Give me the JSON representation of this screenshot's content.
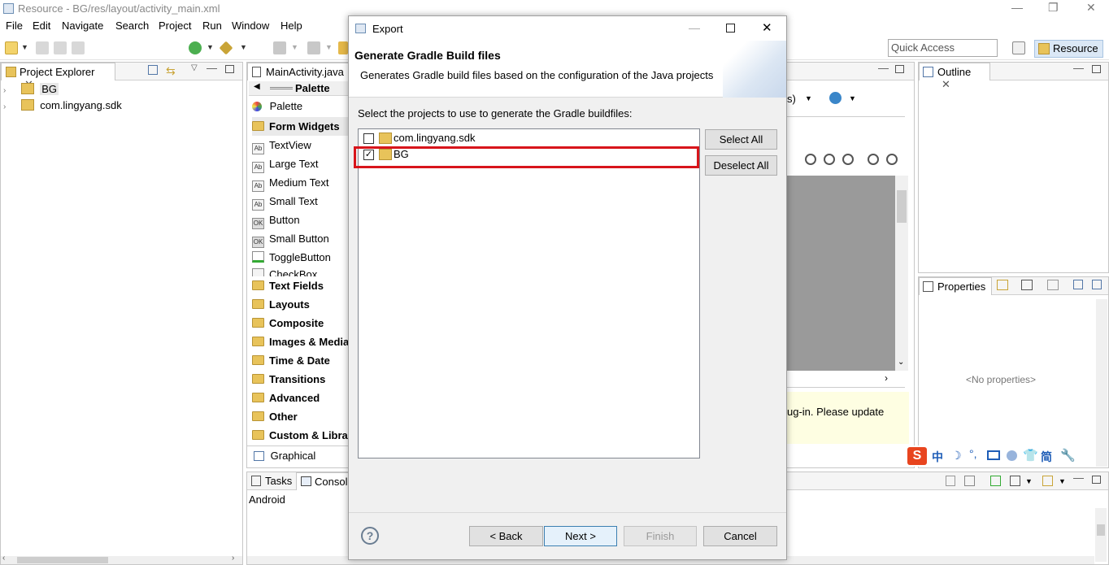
{
  "window": {
    "title": "Resource - BG/res/layout/activity_main.xml",
    "controls": [
      "—",
      "❐",
      "✕"
    ]
  },
  "menu": [
    "File",
    "Edit",
    "Navigate",
    "Search",
    "Project",
    "Run",
    "Window",
    "Help"
  ],
  "toolbar": {
    "quick_access": "Quick Access",
    "perspective": "Resource"
  },
  "project_explorer": {
    "tab": "Project Explorer",
    "items": [
      {
        "label": "BG",
        "selected": true
      },
      {
        "label": "com.lingyang.sdk",
        "selected": false
      }
    ]
  },
  "editor": {
    "tab": "MainActivity.java",
    "palette_header": "Palette",
    "palette_title": "Palette",
    "widgets": [
      {
        "icon": "Ab",
        "label": "TextView"
      },
      {
        "icon": "Ab",
        "label": "Large Text"
      },
      {
        "icon": "Ab",
        "label": "Medium Text"
      },
      {
        "icon": "Ab",
        "label": "Small Text"
      },
      {
        "icon": "OK",
        "label": "Button"
      },
      {
        "icon": "OK",
        "label": "Small Button"
      },
      {
        "icon": "toggle",
        "label": "ToggleButton"
      },
      {
        "icon": "check",
        "label": "CheckBox"
      }
    ],
    "categories": [
      "Form Widgets",
      "Text Fields",
      "Layouts",
      "Composite",
      "Images & Media",
      "Time & Date",
      "Transitions",
      "Advanced",
      "Other",
      "Custom & Library Views"
    ],
    "bottom_tab": "Graphical Layout",
    "warning_text": "ug-in. Please update",
    "device_dropdown": "s)"
  },
  "console": {
    "tabs": [
      "Tasks",
      "Console"
    ],
    "content": "Android"
  },
  "outline": {
    "tab": "Outline"
  },
  "properties": {
    "tab": "Properties",
    "empty": "<No properties>"
  },
  "ime_toolbar": [
    "中",
    "简"
  ],
  "dialog": {
    "title": "Export",
    "heading": "Generate Gradle Build files",
    "description": "Generates Gradle build files based on the configuration of the Java projects",
    "instruction": "Select the projects to use to generate the Gradle buildfiles:",
    "projects": [
      {
        "label": "com.lingyang.sdk",
        "checked": false
      },
      {
        "label": "BG",
        "checked": true
      }
    ],
    "select_all": "Select All",
    "deselect_all": "Deselect All",
    "back": "< Back",
    "next": "Next >",
    "finish": "Finish",
    "cancel": "Cancel",
    "highlight_color": "#d8151b"
  }
}
